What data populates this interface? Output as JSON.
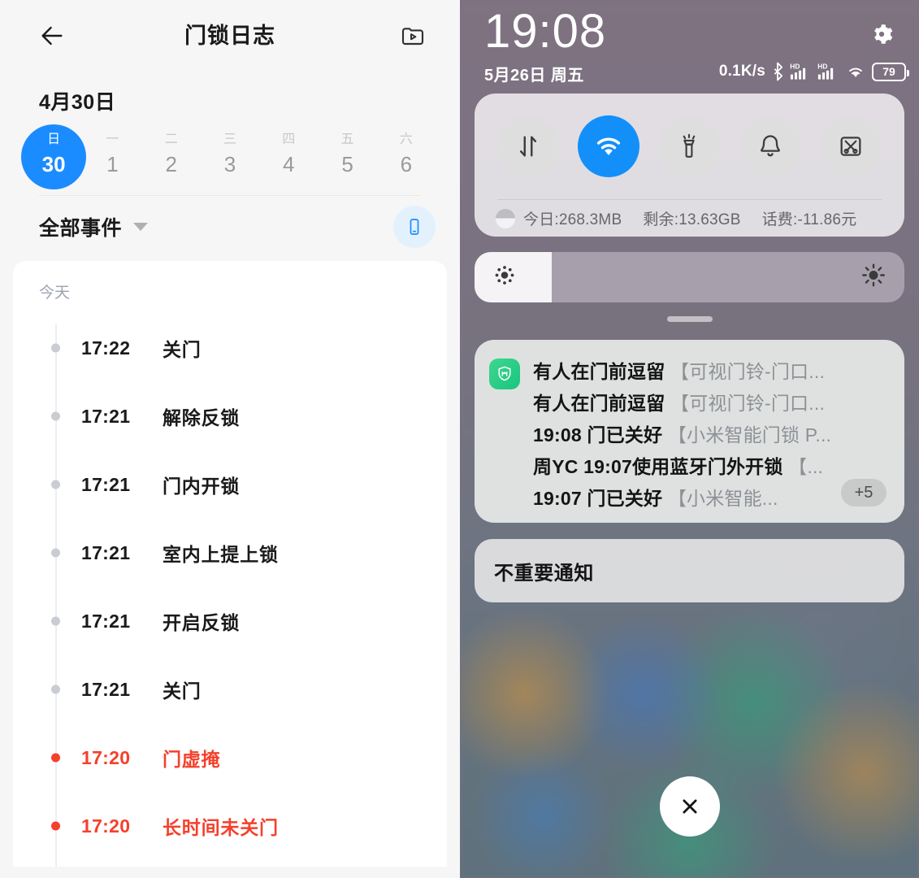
{
  "left": {
    "header": {
      "back_icon": "arrow-left-icon",
      "title": "门锁日志",
      "records_icon": "video-folder-icon"
    },
    "date_title": "4月30日",
    "week_strip": [
      {
        "weekday": "日",
        "day": "30",
        "selected": true
      },
      {
        "weekday": "一",
        "day": "1",
        "selected": false
      },
      {
        "weekday": "二",
        "day": "2",
        "selected": false
      },
      {
        "weekday": "三",
        "day": "3",
        "selected": false
      },
      {
        "weekday": "四",
        "day": "4",
        "selected": false
      },
      {
        "weekday": "五",
        "day": "5",
        "selected": false
      },
      {
        "weekday": "六",
        "day": "6",
        "selected": false
      }
    ],
    "filter": {
      "label": "全部事件",
      "caret_icon": "chevron-down-icon",
      "device_icon": "smartphone-icon"
    },
    "events": {
      "group_label": "今天",
      "items": [
        {
          "time": "17:22",
          "name": "关门",
          "alert": false
        },
        {
          "time": "17:21",
          "name": "解除反锁",
          "alert": false
        },
        {
          "time": "17:21",
          "name": "门内开锁",
          "alert": false
        },
        {
          "time": "17:21",
          "name": "室内上提上锁",
          "alert": false
        },
        {
          "time": "17:21",
          "name": "开启反锁",
          "alert": false
        },
        {
          "time": "17:21",
          "name": "关门",
          "alert": false
        },
        {
          "time": "17:20",
          "name": "门虚掩",
          "alert": true
        },
        {
          "time": "17:20",
          "name": "长时间未关门",
          "alert": true
        }
      ]
    },
    "colors": {
      "accent": "#1a8cff",
      "alert": "#f5402c"
    }
  },
  "right": {
    "status": {
      "time": "19:08",
      "date": "5月26日 周五",
      "gear_icon": "gear-icon",
      "net_speed": "0.1K/s",
      "bluetooth_icon": "bluetooth-icon",
      "signal1_icon": "hd-signal-icon",
      "signal2_icon": "hd-signal-icon",
      "wifi_icon": "wifi-icon",
      "battery_level": "79"
    },
    "quick_settings": {
      "toggles": [
        {
          "name": "mobile-data-toggle",
          "icon": "data-arrows-icon",
          "active": false
        },
        {
          "name": "wifi-toggle",
          "icon": "wifi-icon",
          "active": true
        },
        {
          "name": "flashlight-toggle",
          "icon": "flashlight-icon",
          "active": false
        },
        {
          "name": "ringtone-toggle",
          "icon": "bell-icon",
          "active": false
        },
        {
          "name": "screenshot-toggle",
          "icon": "screenshot-scissors-icon",
          "active": false
        }
      ],
      "stats": [
        "今日:268.3MB",
        "剩余:13.63GB",
        "话费:-11.86元"
      ]
    },
    "brightness": {
      "low_icon": "brightness-low-icon",
      "high_icon": "brightness-high-icon",
      "value_percent": 18
    },
    "notifications": {
      "app_icon": "mi-home-app-icon",
      "lines": [
        {
          "main": "有人在门前逗留 ",
          "sub": "【可视门铃-门口..."
        },
        {
          "main": "有人在门前逗留 ",
          "sub": "【可视门铃-门口..."
        },
        {
          "main": "19:08 门已关好 ",
          "sub": "【小米智能门锁 P..."
        },
        {
          "main": "周YC 19:07使用蓝牙门外开锁 ",
          "sub": "【..."
        },
        {
          "main": "19:07 门已关好 ",
          "sub": "【小米智能..."
        }
      ],
      "more_badge": "+5"
    },
    "minor_notifications": {
      "title": "不重要通知"
    },
    "close_button": {
      "icon": "close-icon"
    }
  }
}
